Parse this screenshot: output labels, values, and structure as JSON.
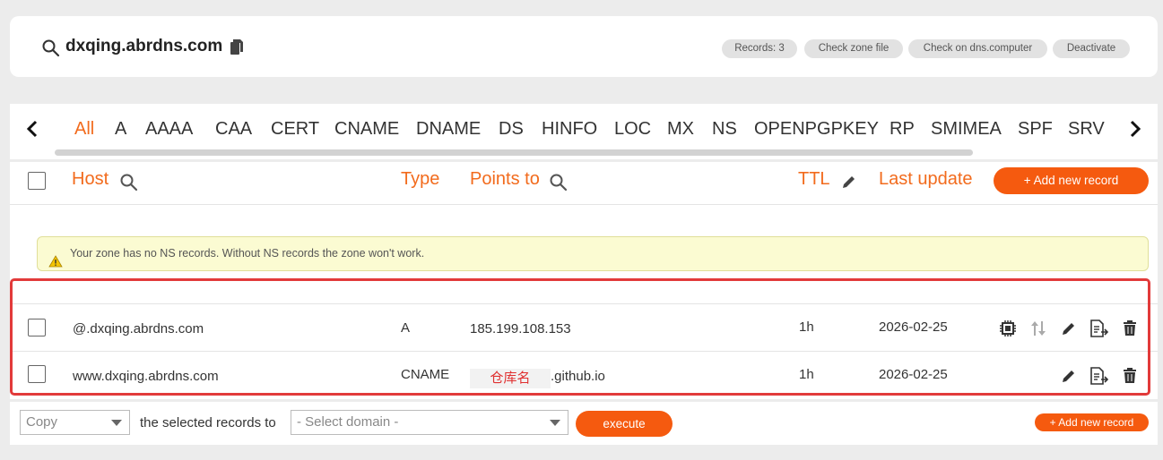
{
  "zone": {
    "name": "dxqing.abrdns.com",
    "pills": [
      "Records: 3",
      "Check zone file",
      "Check on dns.computer",
      "Deactivate"
    ]
  },
  "types": {
    "items": [
      "All",
      "A",
      "AAAA",
      "CAA",
      "CERT",
      "CNAME",
      "DNAME",
      "DS",
      "HINFO",
      "LOC",
      "MX",
      "NS",
      "OPENPGPKEY",
      "RP",
      "SMIMEA",
      "SPF",
      "SRV"
    ],
    "active": "All"
  },
  "table": {
    "headers": {
      "host": "Host",
      "type": "Type",
      "points_to": "Points to",
      "ttl": "TTL",
      "last_update": "Last update"
    },
    "add_button": "+ Add new record",
    "warning": "Your zone has no NS records. Without NS records the zone won't work.",
    "rows": [
      {
        "host": "@.dxqing.abrdns.com",
        "type": "A",
        "points_to": "185.199.108.153",
        "ttl": "1h",
        "last_update": "2026-02-25"
      },
      {
        "host": "www.dxqing.abrdns.com",
        "type": "CNAME",
        "points_to_redacted": "仓库名",
        "points_to": ".github.io",
        "ttl": "1h",
        "last_update": "2026-02-25"
      }
    ]
  },
  "bottom": {
    "action_select": "Copy",
    "label": "the selected records to",
    "domain_select": "- Select domain -",
    "execute": "execute",
    "add_button": "+ Add new record"
  },
  "colors": {
    "accent": "#f26b1d",
    "button": "#f55a0f",
    "highlight": "#e23a3a",
    "warning_bg": "#fbfbd2"
  }
}
